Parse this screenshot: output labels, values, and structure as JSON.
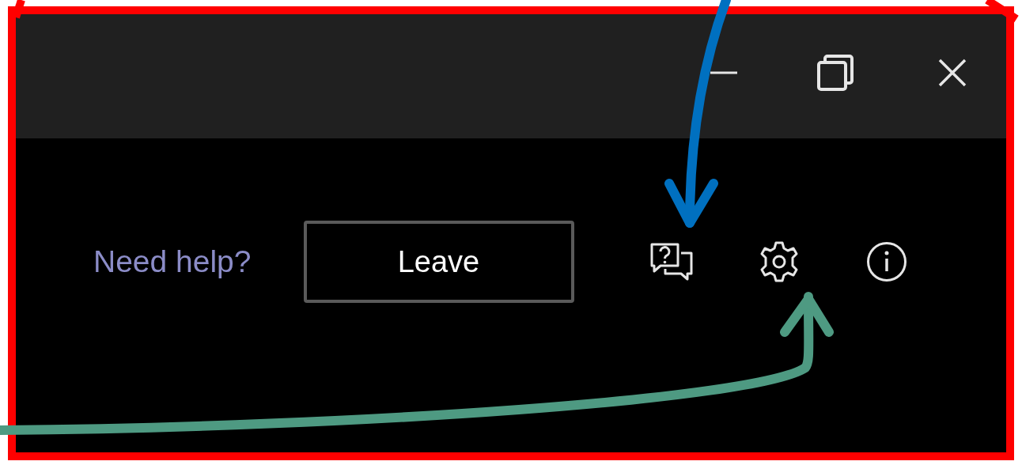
{
  "help_link": {
    "label": "Need help?"
  },
  "leave_button": {
    "label": "Leave"
  }
}
